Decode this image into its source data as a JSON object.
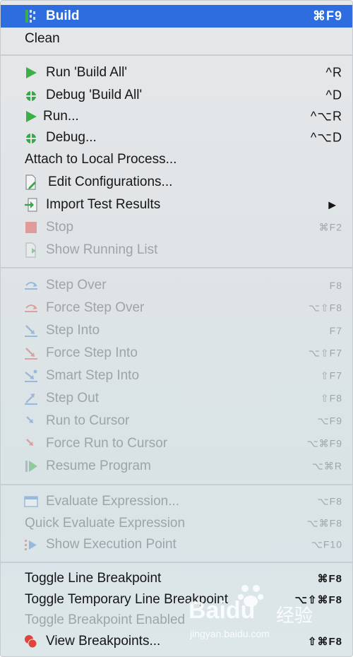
{
  "menu": {
    "items": [
      {
        "label": "Build",
        "shortcut": "⌘F9",
        "highlight": true,
        "disabled": false,
        "icon": "build-icon"
      },
      {
        "label": "Clean",
        "shortcut": "",
        "highlight": false,
        "disabled": false,
        "icon": ""
      },
      {
        "label": "Run 'Build All'",
        "shortcut": "^R",
        "disabled": false,
        "icon": "run-icon"
      },
      {
        "label": "Debug 'Build All'",
        "shortcut": "^D",
        "disabled": false,
        "icon": "debug-icon"
      },
      {
        "label": "Run...",
        "shortcut": "^⌥R",
        "disabled": false,
        "icon": "run-icon"
      },
      {
        "label": "Debug...",
        "shortcut": "^⌥D",
        "disabled": false,
        "icon": "debug-icon"
      },
      {
        "label": "Attach to Local Process...",
        "shortcut": "",
        "disabled": false,
        "icon": ""
      },
      {
        "label": "Edit Configurations...",
        "shortcut": "",
        "disabled": false,
        "icon": "edit-config-icon"
      },
      {
        "label": "Import Test Results",
        "shortcut": "▶",
        "disabled": false,
        "icon": "import-icon"
      },
      {
        "label": "Stop",
        "shortcut": "⌘F2",
        "disabled": true,
        "icon": "stop-icon"
      },
      {
        "label": "Show Running List",
        "shortcut": "",
        "disabled": true,
        "icon": "running-list-icon"
      },
      {
        "label": "Step Over",
        "shortcut": "F8",
        "disabled": true,
        "icon": "step-over-icon"
      },
      {
        "label": "Force Step Over",
        "shortcut": "⌥⇧F8",
        "disabled": true,
        "icon": "force-step-over-icon"
      },
      {
        "label": "Step Into",
        "shortcut": "F7",
        "disabled": true,
        "icon": "step-into-icon"
      },
      {
        "label": "Force Step Into",
        "shortcut": "⌥⇧F7",
        "disabled": true,
        "icon": "force-step-into-icon"
      },
      {
        "label": "Smart Step Into",
        "shortcut": "⇧F7",
        "disabled": true,
        "icon": "smart-step-into-icon"
      },
      {
        "label": "Step Out",
        "shortcut": "⇧F8",
        "disabled": true,
        "icon": "step-out-icon"
      },
      {
        "label": "Run to Cursor",
        "shortcut": "⌥F9",
        "disabled": true,
        "icon": "run-to-cursor-icon"
      },
      {
        "label": "Force Run to Cursor",
        "shortcut": "⌥⌘F9",
        "disabled": true,
        "icon": "force-run-to-cursor-icon"
      },
      {
        "label": "Resume Program",
        "shortcut": "⌥⌘R",
        "disabled": true,
        "icon": "resume-icon"
      },
      {
        "label": "Evaluate Expression...",
        "shortcut": "⌥F8",
        "disabled": true,
        "icon": "evaluate-icon"
      },
      {
        "label": "Quick Evaluate Expression",
        "shortcut": "⌥⌘F8",
        "disabled": true,
        "icon": ""
      },
      {
        "label": "Show Execution Point",
        "shortcut": "⌥F10",
        "disabled": true,
        "icon": "execution-point-icon"
      },
      {
        "label": "Toggle Line Breakpoint",
        "shortcut": "⌘F8",
        "disabled": false,
        "icon": ""
      },
      {
        "label": "Toggle Temporary Line Breakpoint",
        "shortcut": "⌥⇧⌘F8",
        "disabled": false,
        "icon": ""
      },
      {
        "label": "Toggle Breakpoint Enabled",
        "shortcut": "",
        "disabled": true,
        "icon": ""
      },
      {
        "label": "View Breakpoints...",
        "shortcut": "⇧⌘F8",
        "disabled": false,
        "icon": "breakpoints-icon"
      }
    ]
  },
  "watermark": {
    "brand": "Baidu",
    "cn": "经验",
    "url": "jingyan.baidu.com"
  },
  "colors": {
    "highlight": "#2d6de0",
    "run_green": "#3bb045",
    "debug_green": "#3aa64a",
    "stop_red": "#e0453c",
    "disabled_text": "#9ea4a8"
  }
}
